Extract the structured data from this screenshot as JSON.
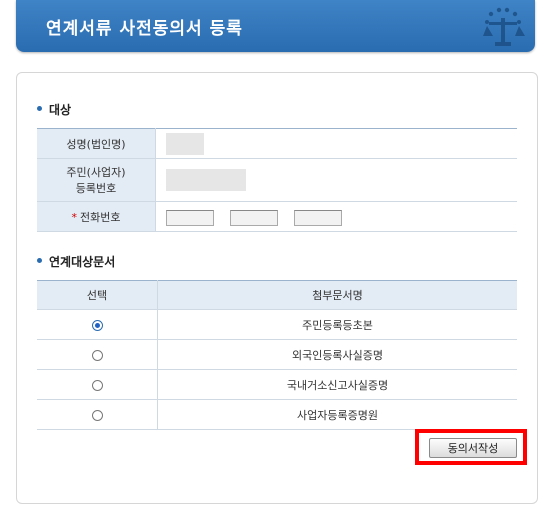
{
  "header": {
    "title": "연계서류 사전동의서 등록"
  },
  "target_section": {
    "title": "대상",
    "rows": {
      "name": {
        "label": "성명(법인명)"
      },
      "reg_no": {
        "label_line1": "주민(사업자)",
        "label_line2": "등록번호"
      },
      "phone": {
        "required_mark": "*",
        "label": "전화번호"
      }
    }
  },
  "docs_section": {
    "title": "연계대상문서",
    "columns": {
      "select": "선택",
      "doc_name": "첨부문서명"
    },
    "rows": [
      {
        "name": "주민등록등초본",
        "selected": true
      },
      {
        "name": "외국인등록사실증명",
        "selected": false
      },
      {
        "name": "국내거소신고사실증명",
        "selected": false
      },
      {
        "name": "사업자등록증명원",
        "selected": false
      }
    ]
  },
  "actions": {
    "create_consent_label": "동의서작성"
  },
  "colors": {
    "header_blue": "#2a6cb0",
    "highlight_red": "#ff0000",
    "label_bg": "#e3ebf4"
  }
}
